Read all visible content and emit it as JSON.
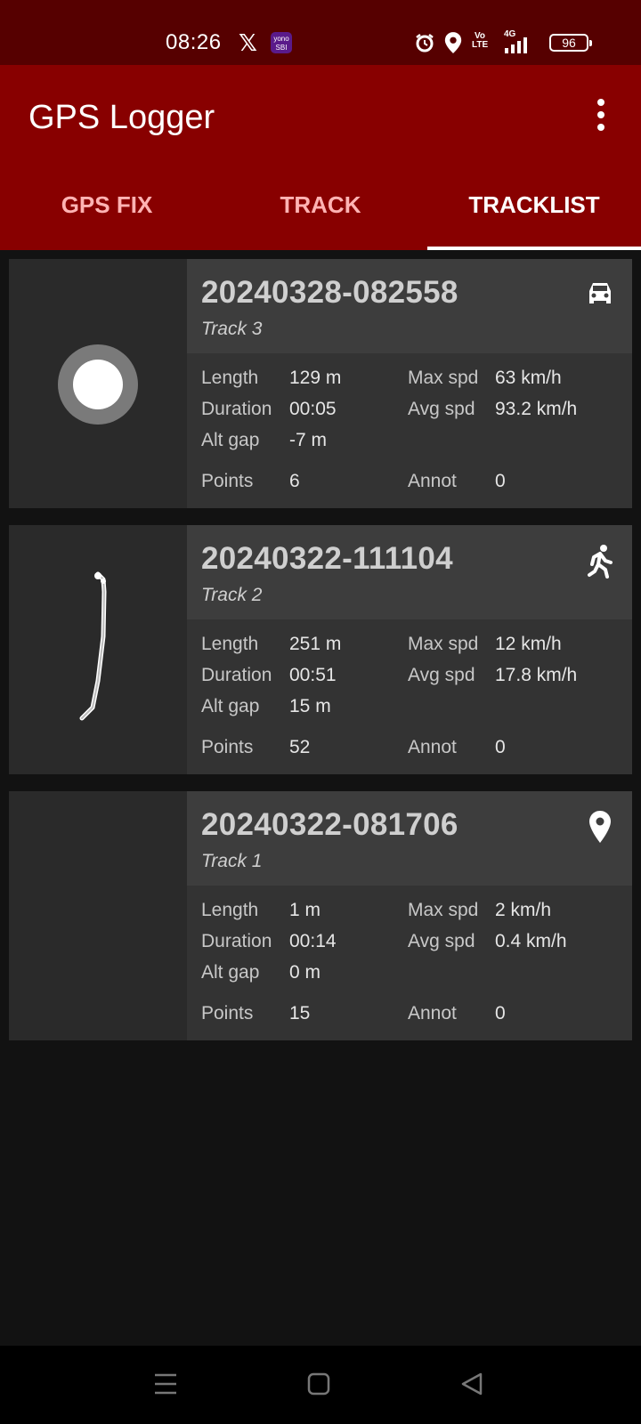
{
  "status_bar": {
    "time": "08:26",
    "x_glyph": "𝕏",
    "yono_label": "yono SBI",
    "volte": "Vo LTE",
    "network": "4G",
    "battery": "96",
    "icons": [
      "x-logo-icon",
      "yono-sbi-icon",
      "alarm-icon",
      "location-icon",
      "volte-icon",
      "signal-icon",
      "battery-icon"
    ]
  },
  "app_bar": {
    "title": "GPS Logger",
    "menu_icon": "more-vert-icon"
  },
  "tabs": [
    {
      "label": "GPS FIX",
      "active": false
    },
    {
      "label": "TRACK",
      "active": false
    },
    {
      "label": "TRACKLIST",
      "active": true
    }
  ],
  "labels": {
    "length": "Length",
    "duration": "Duration",
    "alt_gap": "Alt gap",
    "points": "Points",
    "max_spd": "Max spd",
    "avg_spd": "Avg spd",
    "annot": "Annot"
  },
  "tracks": [
    {
      "id": "20240328-082558",
      "name": "Track 3",
      "type_icon": "car-icon",
      "thumbnail": "single-point-icon",
      "length": "129 m",
      "duration": "00:05",
      "alt_gap": "-7 m",
      "points": "6",
      "max_spd": "63 km/h",
      "avg_spd": "93.2 km/h",
      "annot": "0"
    },
    {
      "id": "20240322-111104",
      "name": "Track 2",
      "type_icon": "walk-icon",
      "thumbnail": "track-path-icon",
      "length": "251 m",
      "duration": "00:51",
      "alt_gap": "15 m",
      "points": "52",
      "max_spd": "12 km/h",
      "avg_spd": "17.8 km/h",
      "annot": "0"
    },
    {
      "id": "20240322-081706",
      "name": "Track 1",
      "type_icon": "place-icon",
      "thumbnail": "empty",
      "length": "1 m",
      "duration": "00:14",
      "alt_gap": "0 m",
      "points": "15",
      "max_spd": "2 km/h",
      "avg_spd": "0.4 km/h",
      "annot": "0"
    }
  ],
  "nav_bar": {
    "buttons": [
      "menu-nav-icon",
      "home-nav-icon",
      "back-nav-icon"
    ]
  },
  "colors": {
    "status_bar": "#560000",
    "app_bar": "#880000",
    "background": "#121212",
    "card": "#2a2a2a",
    "card_header": "#3d3d3d"
  }
}
